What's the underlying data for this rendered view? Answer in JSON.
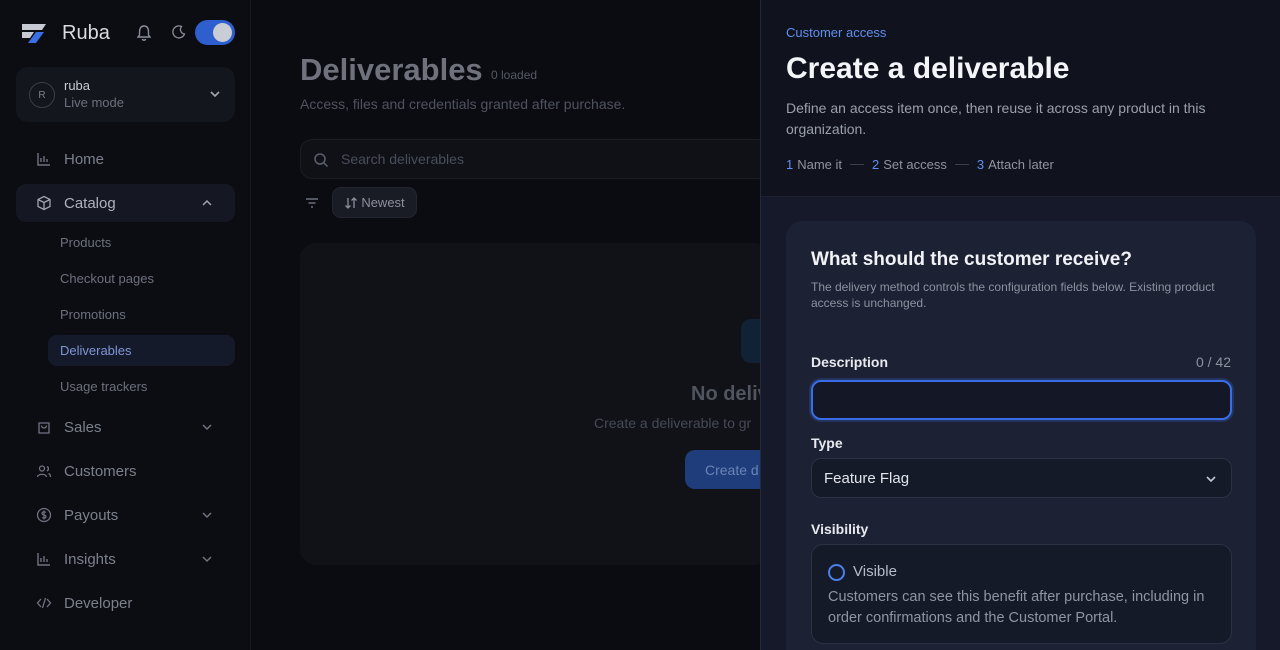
{
  "brand": {
    "name": "Ruba"
  },
  "account": {
    "avatar_initial": "R",
    "username": "ruba",
    "mode": "Live mode"
  },
  "nav": {
    "home": "Home",
    "catalog": "Catalog",
    "catalog_items": [
      "Products",
      "Checkout pages",
      "Promotions",
      "Deliverables",
      "Usage trackers"
    ],
    "sales": "Sales",
    "customers": "Customers",
    "payouts": "Payouts",
    "insights": "Insights",
    "developer": "Developer"
  },
  "main": {
    "title": "Deliverables",
    "loaded": "0 loaded",
    "subtitle": "Access, files and credentials granted after purchase.",
    "search_placeholder": "Search deliverables",
    "sort_label": "Newest",
    "empty_title": "No delive",
    "empty_sub": "Create a deliverable to gr",
    "empty_button": "Create d"
  },
  "drawer": {
    "kicker": "Customer access",
    "title": "Create a deliverable",
    "description": "Define an access item once, then reuse it across any product in this organization.",
    "steps": [
      {
        "num": "1",
        "label": "Name it"
      },
      {
        "num": "2",
        "label": "Set access"
      },
      {
        "num": "3",
        "label": "Attach later"
      }
    ],
    "form": {
      "title": "What should the customer receive?",
      "help": "The delivery method controls the configuration fields below. Existing product access is unchanged.",
      "description_label": "Description",
      "description_value": "",
      "description_counter": "0 / 42",
      "type_label": "Type",
      "type_value": "Feature Flag",
      "visibility_label": "Visibility",
      "visibility_option": "Visible",
      "visibility_desc": "Customers can see this benefit after purchase, including in order confirmations and the Customer Portal."
    }
  },
  "colors": {
    "accent": "#3a6ee6",
    "toggle": "#2f5fcf",
    "link": "#5f8ff0"
  }
}
